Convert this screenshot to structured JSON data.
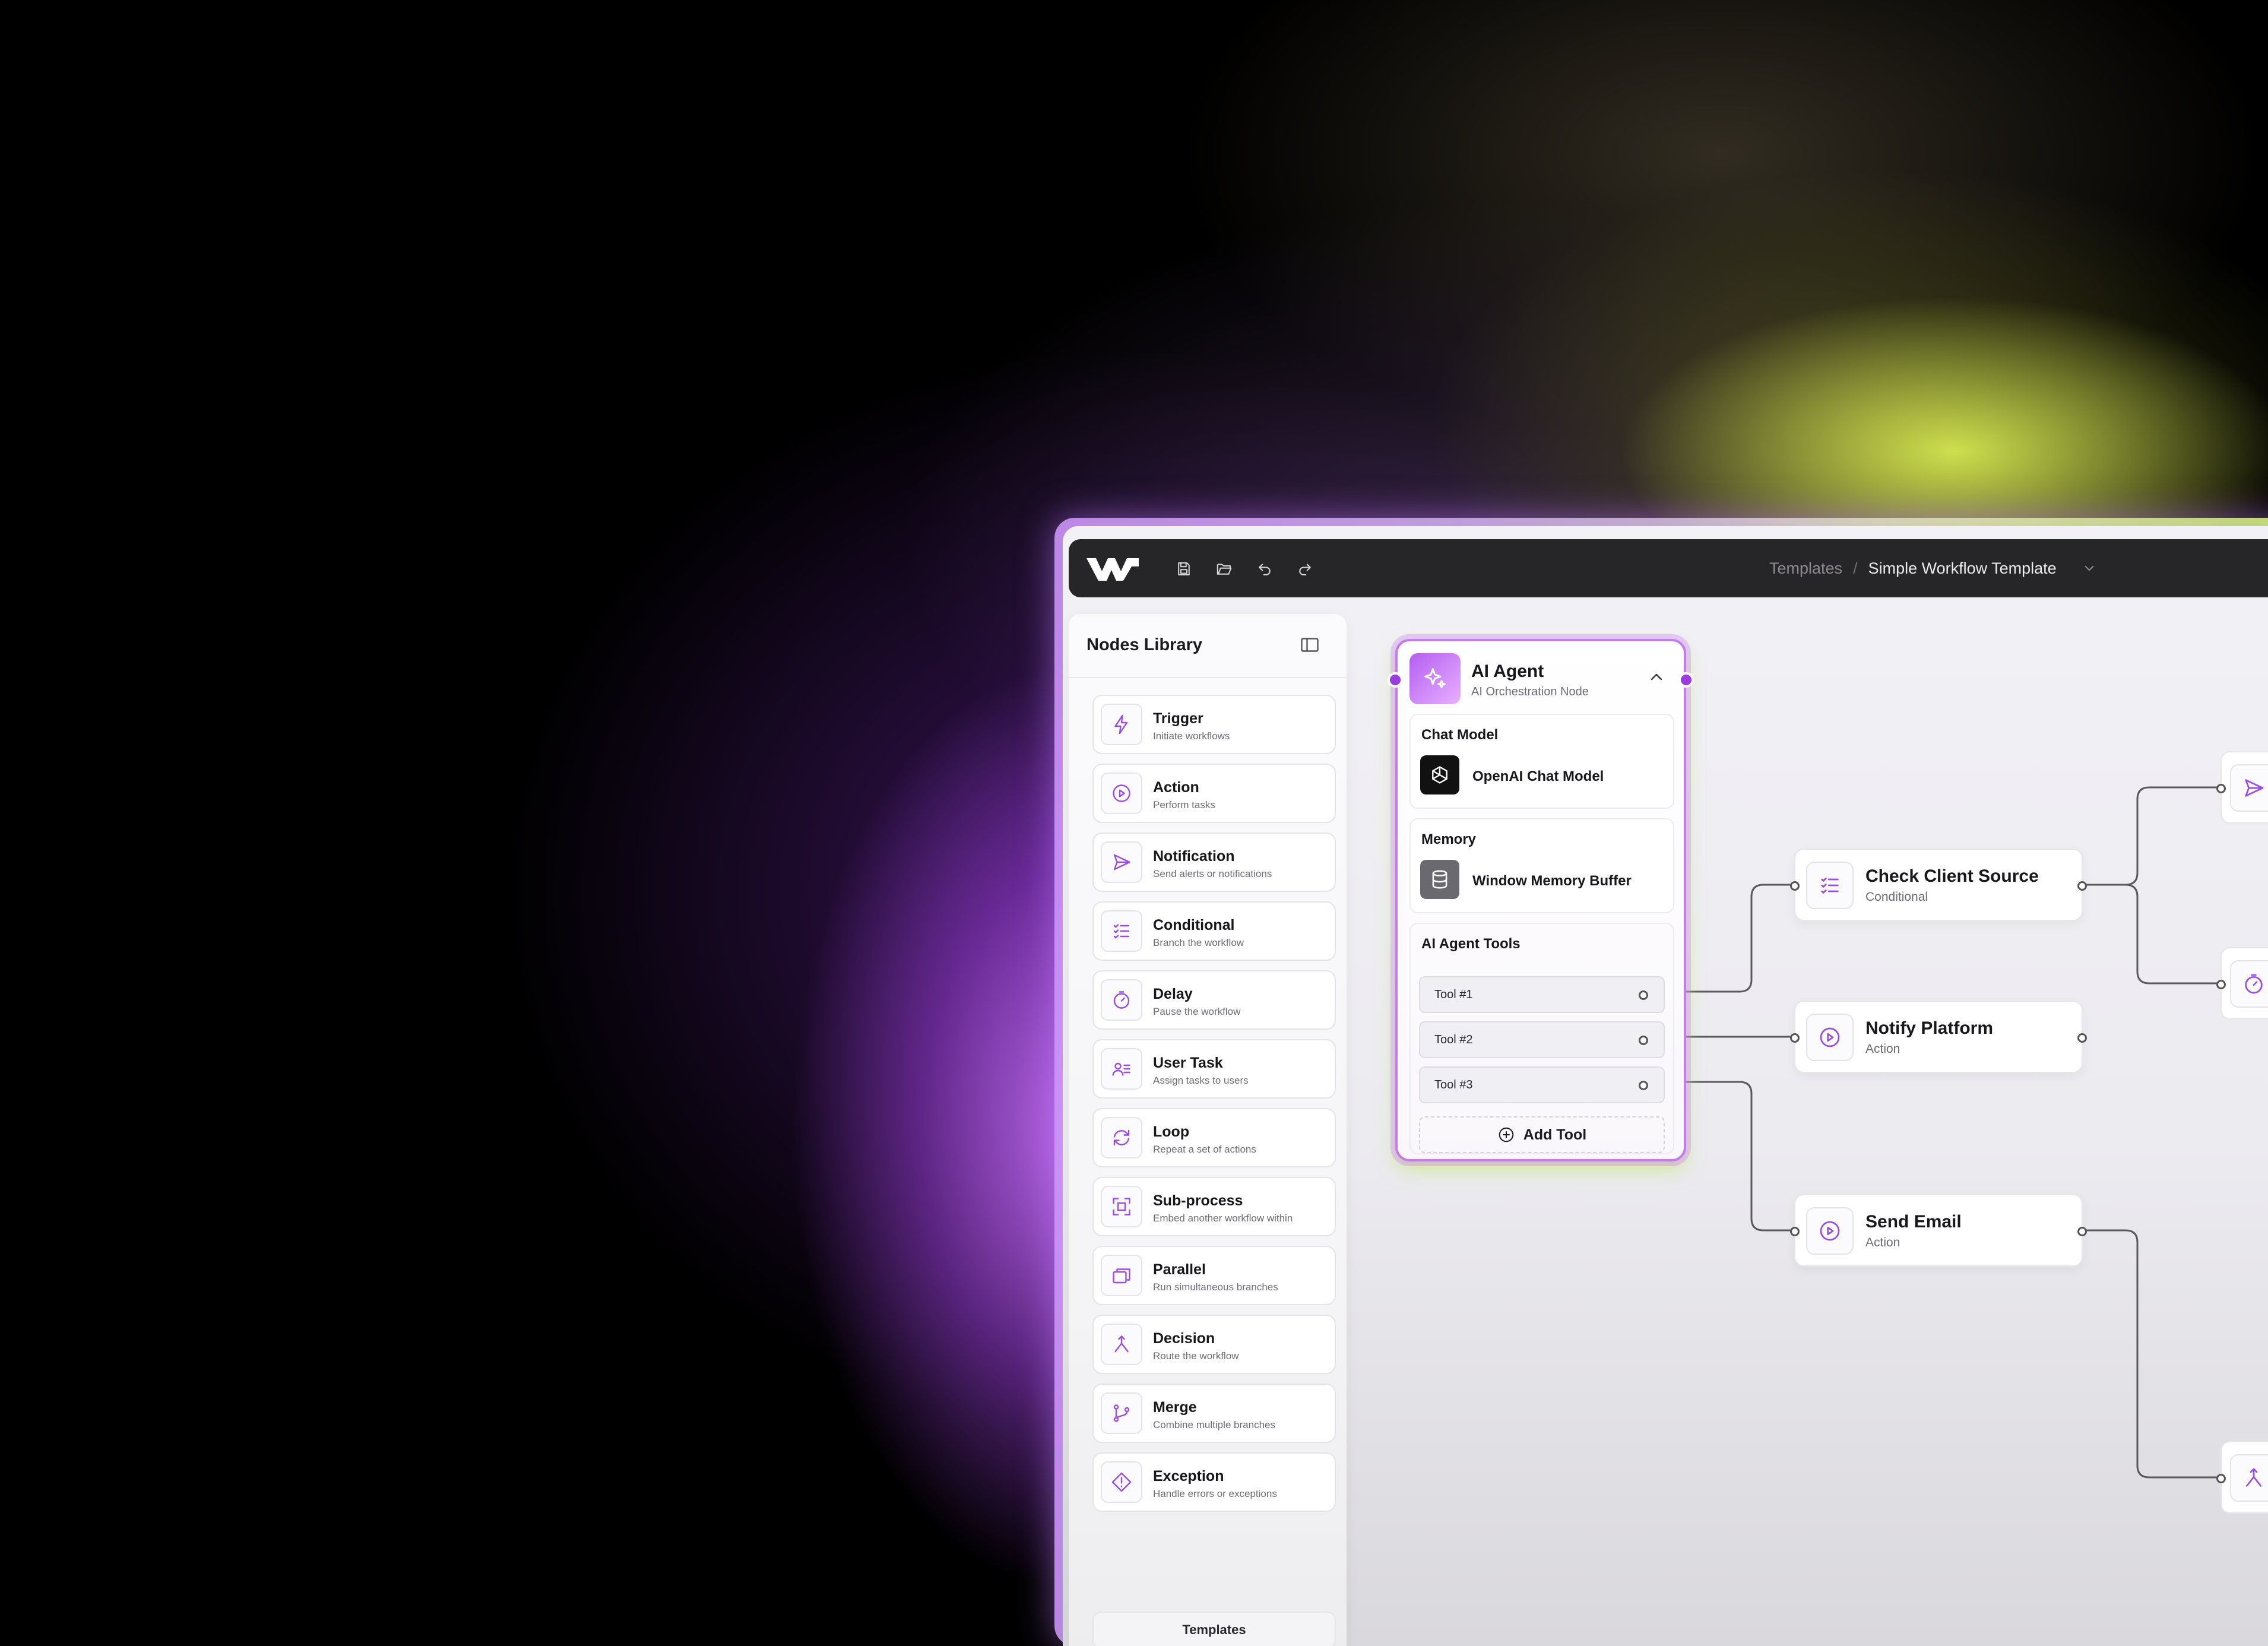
{
  "colors": {
    "accent": "#9b3be0",
    "icon_stroke": "#9b4ce0",
    "topbar": "#262527",
    "canvas": "#ecebf0",
    "glow_purple": "#c46ef5",
    "glow_yellow": "#d6e850"
  },
  "topbar": {
    "logo": "app-logo",
    "actions": [
      {
        "name": "save-icon"
      },
      {
        "name": "open-folder-icon"
      },
      {
        "name": "undo-icon"
      },
      {
        "name": "redo-icon"
      }
    ],
    "breadcrumb": {
      "parent": "Templates",
      "separator": "/",
      "current": "Simple Workflow Template"
    }
  },
  "sidebar": {
    "title": "Nodes Library",
    "items": [
      {
        "title": "Trigger",
        "subtitle": "Initiate workflows",
        "icon": "lightning-icon"
      },
      {
        "title": "Action",
        "subtitle": "Perform tasks",
        "icon": "play-circle-icon"
      },
      {
        "title": "Notification",
        "subtitle": "Send alerts or notifications",
        "icon": "send-icon"
      },
      {
        "title": "Conditional",
        "subtitle": "Branch the workflow",
        "icon": "checklist-icon"
      },
      {
        "title": "Delay",
        "subtitle": "Pause the workflow",
        "icon": "timer-icon"
      },
      {
        "title": "User Task",
        "subtitle": "Assign tasks to users",
        "icon": "user-list-icon"
      },
      {
        "title": "Loop",
        "subtitle": "Repeat a set of actions",
        "icon": "loop-icon"
      },
      {
        "title": "Sub-process",
        "subtitle": "Embed another workflow within",
        "icon": "frame-icon"
      },
      {
        "title": "Parallel",
        "subtitle": "Run simultaneous branches",
        "icon": "stack-icon"
      },
      {
        "title": "Decision",
        "subtitle": "Route the workflow",
        "icon": "split-icon"
      },
      {
        "title": "Merge",
        "subtitle": "Combine multiple branches",
        "icon": "merge-icon"
      },
      {
        "title": "Exception",
        "subtitle": "Handle errors or exceptions",
        "icon": "warning-diamond-icon"
      }
    ],
    "templates_label": "Templates"
  },
  "agent": {
    "title": "AI Agent",
    "subtitle": "AI Orchestration Node",
    "chat_model": {
      "label": "Chat Model",
      "value": "OpenAI Chat Model"
    },
    "memory": {
      "label": "Memory",
      "value": "Window Memory Buffer"
    },
    "tools": {
      "label": "AI Agent Tools",
      "items": [
        "Tool #1",
        "Tool #2",
        "Tool #3"
      ],
      "add_label": "Add Tool"
    }
  },
  "flow_nodes": [
    {
      "title": "Check Client Source",
      "subtitle": "Conditional",
      "icon": "checklist-icon"
    },
    {
      "title": "Notify Platform",
      "subtitle": "Action",
      "icon": "play-circle-icon"
    },
    {
      "title": "Send Email",
      "subtitle": "Action",
      "icon": "play-circle-icon"
    }
  ]
}
